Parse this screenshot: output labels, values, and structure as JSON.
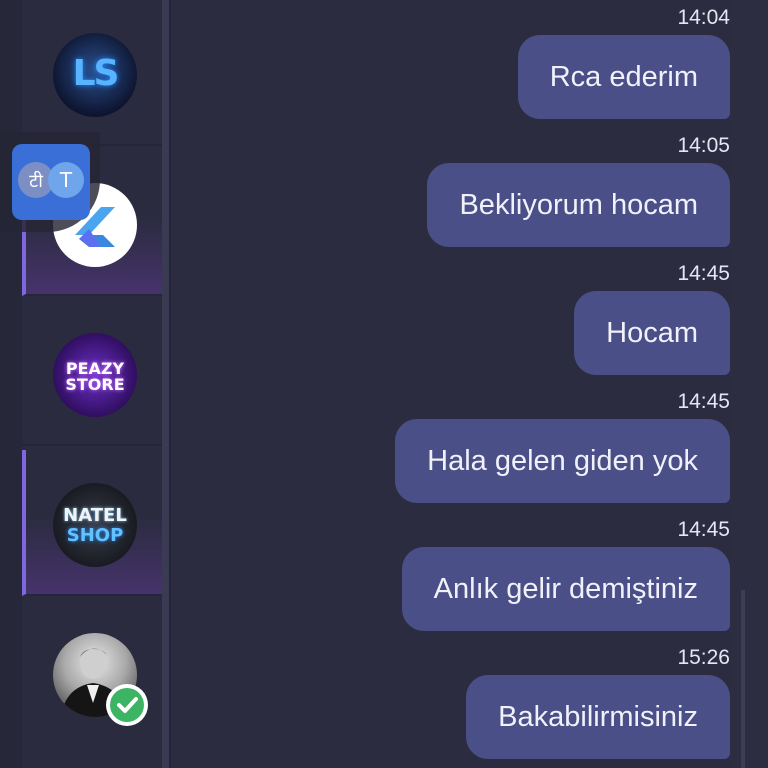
{
  "sidebar": {
    "chats": [
      {
        "avatar": "ls-logo-avatar",
        "monogram": "LS",
        "active": false
      },
      {
        "avatar": "k-logo-avatar",
        "active": true
      },
      {
        "avatar": "peazy-store-avatar",
        "line1": "PEAZY",
        "line2": "STORE",
        "active": false
      },
      {
        "avatar": "natel-shop-avatar",
        "line1": "NATEL",
        "line2": "SHOP",
        "active": true
      },
      {
        "avatar": "portrait-avatar",
        "verified": true,
        "active": false
      }
    ]
  },
  "translate_overlay": {
    "icon": "translate-icon",
    "glyph_left": "टी",
    "glyph_right": "T"
  },
  "messages": [
    {
      "time": "14:04",
      "text": "Rca ederim"
    },
    {
      "time": "14:05",
      "text": "Bekliyorum hocam"
    },
    {
      "time": "14:45",
      "text": "Hocam"
    },
    {
      "time": "14:45",
      "text": "Hala gelen giden yok"
    },
    {
      "time": "14:45",
      "text": "Anlık gelir demiştiniz"
    },
    {
      "time": "15:26",
      "text": "Bakabilirmisiniz"
    }
  ],
  "colors": {
    "background": "#2b2c3f",
    "bubble": "#4b4f87",
    "accent": "#7f67e0",
    "verified": "#3cb463"
  }
}
